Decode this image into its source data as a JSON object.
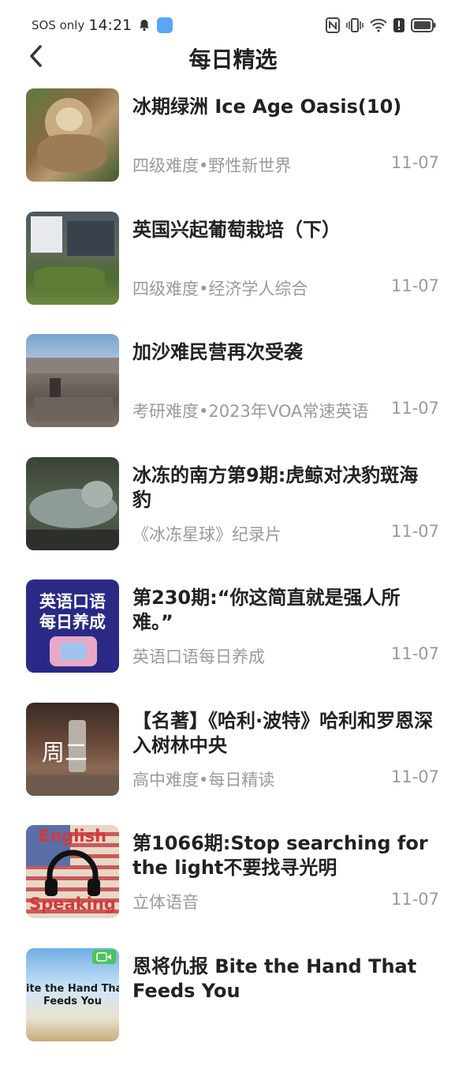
{
  "status": {
    "sos": "SOS only",
    "time": "14:21",
    "nfc": "N",
    "alert": "!"
  },
  "header": {
    "title": "每日精选"
  },
  "items": [
    {
      "title": "冰期绿洲 Ice Age Oasis(10)",
      "meta": "四级难度•野性新世界",
      "date": "11-07",
      "thumb_icon": "sloth-photo"
    },
    {
      "title": "英国兴起葡萄栽培（下）",
      "meta": "四级难度•经济学人综合",
      "date": "11-07",
      "thumb_icon": "vineyard-photo"
    },
    {
      "title": "加沙难民营再次受袭",
      "meta": "考研难度•2023年VOA常速英语",
      "date": "11-07",
      "thumb_icon": "rubble-photo"
    },
    {
      "title": "冰冻的南方第9期:虎鲸对决豹斑海豹",
      "meta": "《冰冻星球》纪录片",
      "date": "11-07",
      "thumb_icon": "seal-photo"
    },
    {
      "title": "第230期:“你这简直就是强人所难。”",
      "meta": "英语口语每日养成",
      "date": "11-07",
      "thumb_icon": "cover-art",
      "thumb_text": [
        "英语口语",
        "每日养成"
      ]
    },
    {
      "title": "【名著】《哈利·波特》哈利和罗恩深入树林中央",
      "meta": "高中难度•每日精读",
      "date": "11-07",
      "thumb_icon": "hourglass-photo",
      "thumb_text": [
        "周二"
      ]
    },
    {
      "title": "第1066期:Stop searching for the light不要找寻光明",
      "meta": "立体语音",
      "date": "11-07",
      "thumb_icon": "headphones-art",
      "thumb_text": [
        "English",
        "Speaking"
      ]
    },
    {
      "title": "恩将仇报 Bite the Hand That Feeds You",
      "meta": "",
      "date": "",
      "thumb_icon": "sky-photo",
      "thumb_text": [
        "ite the Hand Tha",
        "Feeds You"
      ]
    }
  ]
}
